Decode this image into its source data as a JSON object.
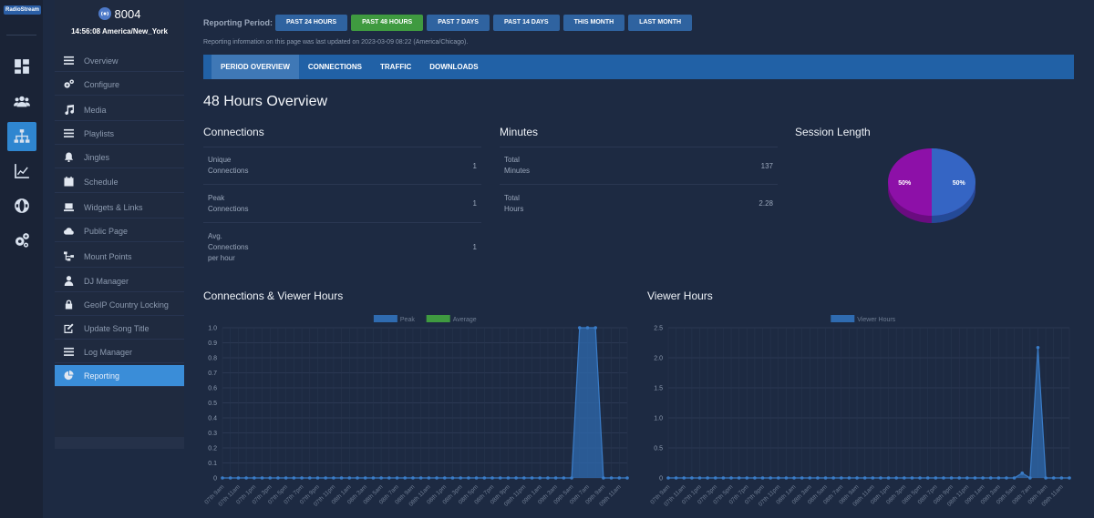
{
  "colors": {
    "accent": "#2f86d0",
    "active_period": "#3f9a40",
    "period_btn": "#2f63a0",
    "tabbar": "#2161a6",
    "series": "#2f6bb0",
    "average": "#3f9a40",
    "pie_a": "#3565c4",
    "pie_b": "#8d10a8"
  },
  "rail": {
    "logo_text": "RadioStream",
    "items": [
      {
        "icon": "dashboard-icon"
      },
      {
        "icon": "users-icon"
      },
      {
        "icon": "sitemap-icon"
      },
      {
        "icon": "line-chart-icon"
      },
      {
        "icon": "globe-icon"
      },
      {
        "icon": "gears-icon"
      }
    ]
  },
  "server": {
    "port": "8004",
    "time": "14:56:08 America/New_York"
  },
  "menu": {
    "items": [
      {
        "label": "Overview",
        "icon": "list-icon"
      },
      {
        "label": "Configure",
        "icon": "cogs-icon"
      },
      {
        "label": "Media",
        "icon": "music-icon"
      },
      {
        "label": "Playlists",
        "icon": "list-icon"
      },
      {
        "label": "Jingles",
        "icon": "bell-icon"
      },
      {
        "label": "Schedule",
        "icon": "calendar-icon"
      },
      {
        "label": "Widgets & Links",
        "icon": "laptop-icon"
      },
      {
        "label": "Public Page",
        "icon": "cloud-icon"
      },
      {
        "label": "Mount Points",
        "icon": "sitemap-icon"
      },
      {
        "label": "DJ Manager",
        "icon": "user-icon"
      },
      {
        "label": "GeoIP Country Locking",
        "icon": "lock-icon"
      },
      {
        "label": "Update Song Title",
        "icon": "edit-icon"
      },
      {
        "label": "Log Manager",
        "icon": "list-icon"
      },
      {
        "label": "Reporting",
        "icon": "pie-chart-icon",
        "active": true
      }
    ]
  },
  "period": {
    "label": "Reporting Period:",
    "buttons": [
      "PAST 24 HOURS",
      "PAST 48 HOURS",
      "PAST 7 DAYS",
      "PAST 14 DAYS",
      "THIS MONTH",
      "LAST MONTH"
    ],
    "active": "PAST 48 HOURS"
  },
  "updated_text": "Reporting information on this page was last updated on 2023-03-09 08:22 (America/Chicago).",
  "tabs": [
    "PERIOD OVERVIEW",
    "CONNECTIONS",
    "TRAFFIC",
    "DOWNLOADS"
  ],
  "page_title": "48 Hours Overview",
  "connections": {
    "title": "Connections",
    "rows": [
      {
        "label": [
          "Unique",
          "Connections"
        ],
        "value": "1"
      },
      {
        "label": [
          "Peak",
          "Connections"
        ],
        "value": "1"
      },
      {
        "label": [
          "Avg.",
          "Connections",
          "per hour"
        ],
        "value": "1"
      }
    ]
  },
  "minutes": {
    "title": "Minutes",
    "rows": [
      {
        "label": [
          "Total",
          "Minutes"
        ],
        "value": "137"
      },
      {
        "label": [
          "Total",
          "Hours"
        ],
        "value": "2.28"
      }
    ]
  },
  "session": {
    "title": "Session Length"
  },
  "chart_data": [
    {
      "type": "pie",
      "title": "Session Length",
      "slices": [
        {
          "label": "50%",
          "value": 50,
          "color": "#3565c4"
        },
        {
          "label": "50%",
          "value": 50,
          "color": "#8d10a8"
        }
      ]
    },
    {
      "type": "area",
      "title": "Connections & Viewer Hours",
      "legend": [
        "Peak",
        "Average"
      ],
      "ylim": [
        0,
        1.0
      ],
      "yticks": [
        "1.0",
        "0.9",
        "0.8",
        "0.7",
        "0.6",
        "0.5",
        "0.4",
        "0.3",
        "0.2",
        "0.1",
        "0"
      ],
      "categories": [
        "07th 9am",
        "07th 10am",
        "07th 11am",
        "07th 12pm",
        "07th 1pm",
        "07th 2pm",
        "07th 3pm",
        "07th 4pm",
        "07th 5pm",
        "07th 6pm",
        "07th 7pm",
        "07th 8pm",
        "07th 9pm",
        "07th 10pm",
        "07th 11pm",
        "08th 12am",
        "08th 1am",
        "08th 2am",
        "08th 3am",
        "08th 4am",
        "08th 5am",
        "08th 6am",
        "08th 7am",
        "08th 8am",
        "08th 9am",
        "08th 10am",
        "08th 11am",
        "08th 12pm",
        "08th 1pm",
        "08th 2pm",
        "08th 3pm",
        "08th 4pm",
        "08th 5pm",
        "08th 6pm",
        "08th 7pm",
        "08th 8pm",
        "08th 9pm",
        "08th 10pm",
        "08th 11pm",
        "09th 12am",
        "09th 1am",
        "09th 2am",
        "09th 3am",
        "09th 4am",
        "09th 5am",
        "09th 6am",
        "09th 7am",
        "09th 8am",
        "09th 9am",
        "09th 10am",
        "09th 11am",
        "09th 12pm"
      ],
      "xtick_labels": [
        "07th 9am",
        "07th 11am",
        "07th 1pm",
        "07th 3pm",
        "07th 5pm",
        "07th 7pm",
        "07th 9pm",
        "07th 11pm",
        "08th 1am",
        "08th 3am",
        "08th 5am",
        "08th 7am",
        "08th 9am",
        "08th 11am",
        "08th 1pm",
        "08th 3pm",
        "08th 5pm",
        "08th 7pm",
        "08th 9pm",
        "08th 11pm",
        "09th 1am",
        "09th 3am",
        "09th 5am",
        "09th 7am",
        "09th 9am",
        "09th 11am"
      ],
      "series": [
        {
          "name": "Peak",
          "values": [
            0,
            0,
            0,
            0,
            0,
            0,
            0,
            0,
            0,
            0,
            0,
            0,
            0,
            0,
            0,
            0,
            0,
            0,
            0,
            0,
            0,
            0,
            0,
            0,
            0,
            0,
            0,
            0,
            0,
            0,
            0,
            0,
            0,
            0,
            0,
            0,
            0,
            0,
            0,
            0,
            0,
            0,
            0,
            0,
            0,
            1,
            1,
            1,
            0,
            0,
            0,
            0
          ]
        }
      ]
    },
    {
      "type": "area",
      "title": "Viewer Hours",
      "legend": [
        "Viewer Hours"
      ],
      "ylim": [
        0,
        2.5
      ],
      "yticks": [
        "2.5",
        "2.0",
        "1.5",
        "1.0",
        "0.5",
        "0"
      ],
      "categories": [
        "07th 9am",
        "07th 10am",
        "07th 11am",
        "07th 12pm",
        "07th 1pm",
        "07th 2pm",
        "07th 3pm",
        "07th 4pm",
        "07th 5pm",
        "07th 6pm",
        "07th 7pm",
        "07th 8pm",
        "07th 9pm",
        "07th 10pm",
        "07th 11pm",
        "08th 12am",
        "08th 1am",
        "08th 2am",
        "08th 3am",
        "08th 4am",
        "08th 5am",
        "08th 6am",
        "08th 7am",
        "08th 8am",
        "08th 9am",
        "08th 10am",
        "08th 11am",
        "08th 12pm",
        "08th 1pm",
        "08th 2pm",
        "08th 3pm",
        "08th 4pm",
        "08th 5pm",
        "08th 6pm",
        "08th 7pm",
        "08th 8pm",
        "08th 9pm",
        "08th 10pm",
        "08th 11pm",
        "09th 12am",
        "09th 1am",
        "09th 2am",
        "09th 3am",
        "09th 4am",
        "09th 5am",
        "09th 6am",
        "09th 7am",
        "09th 8am",
        "09th 9am",
        "09th 10am",
        "09th 11am",
        "09th 12pm"
      ],
      "xtick_labels": [
        "07th 9am",
        "07th 11am",
        "07th 1pm",
        "07th 3pm",
        "07th 5pm",
        "07th 7pm",
        "07th 9pm",
        "07th 11pm",
        "08th 1am",
        "08th 3am",
        "08th 5am",
        "08th 7am",
        "08th 9am",
        "08th 11am",
        "08th 1pm",
        "08th 3pm",
        "08th 5pm",
        "08th 7pm",
        "08th 9pm",
        "08th 11pm",
        "09th 1am",
        "09th 3am",
        "09th 5am",
        "09th 7am",
        "09th 9am",
        "09th 11am"
      ],
      "series": [
        {
          "name": "Viewer Hours",
          "values": [
            0,
            0,
            0,
            0,
            0,
            0,
            0,
            0,
            0,
            0,
            0,
            0,
            0,
            0,
            0,
            0,
            0,
            0,
            0,
            0,
            0,
            0,
            0,
            0,
            0,
            0,
            0,
            0,
            0,
            0,
            0,
            0,
            0,
            0,
            0,
            0,
            0,
            0,
            0,
            0,
            0,
            0,
            0,
            0,
            0,
            0.08,
            0,
            2.17,
            0,
            0,
            0,
            0
          ]
        }
      ]
    }
  ]
}
